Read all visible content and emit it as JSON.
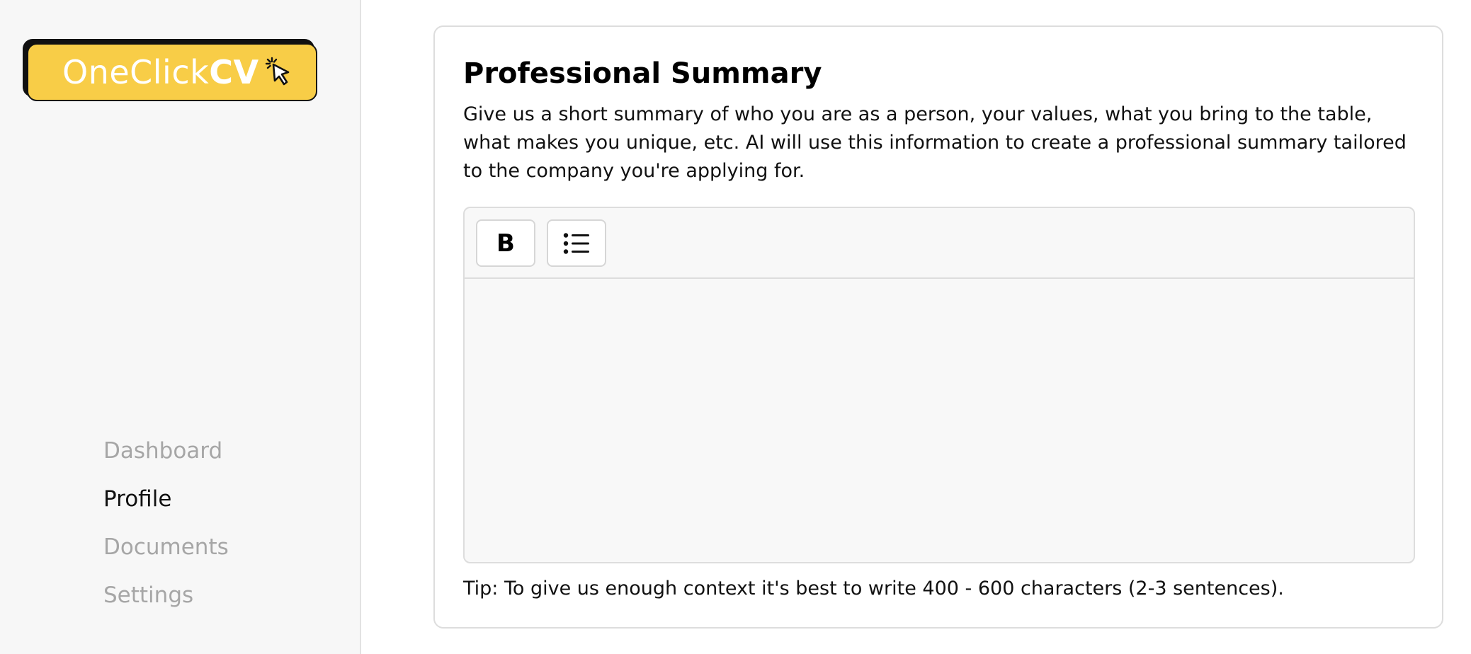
{
  "app": {
    "logo_light": "OneClick",
    "logo_bold": "CV",
    "brand_color": "#f8cd47"
  },
  "sidebar": {
    "items": [
      {
        "label": "Dashboard",
        "active": false
      },
      {
        "label": "Profile",
        "active": true
      },
      {
        "label": "Documents",
        "active": false
      },
      {
        "label": "Settings",
        "active": false
      }
    ]
  },
  "section": {
    "title": "Professional Summary",
    "description": "Give us a short summary of who you are as a person, your values, what you bring to the table, what makes you unique, etc. AI will use this information to create a professional summary tailored to the company you're applying for.",
    "tip": "Tip: To give us enough context it's best to write 400 - 600 characters (2-3 sentences)."
  },
  "editor": {
    "bold_label": "B",
    "list_icon": "bullet-list-icon",
    "content": ""
  }
}
